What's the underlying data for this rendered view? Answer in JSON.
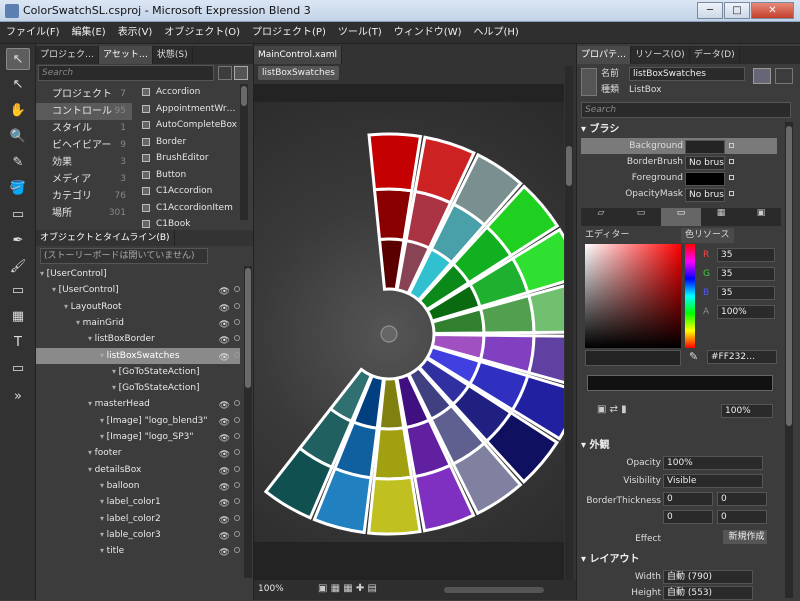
{
  "window": {
    "title": "ColorSwatchSL.csproj - Microsoft Expression Blend 3",
    "min": "─",
    "max": "□",
    "close": "✕"
  },
  "menu": [
    "ファイル(F)",
    "編集(E)",
    "表示(V)",
    "オブジェクト(O)",
    "プロジェクト(P)",
    "ツール(T)",
    "ウィンドウ(W)",
    "ヘルプ(H)"
  ],
  "toolbox": {
    "icons": [
      "selection-arrow-icon",
      "direct-select-icon",
      "pan-hand-icon",
      "zoom-icon",
      "eyedropper-icon",
      "paint-bucket-icon",
      "gradient-icon",
      "pen-icon",
      "brush-icon",
      "rectangle-icon",
      "grid-icon",
      "textblock-icon",
      "asset-icon",
      "expand-icon"
    ],
    "glyphs": [
      "↖",
      "↖",
      "✋",
      "🔍",
      "✎",
      "🪣",
      "▭",
      "✒",
      "🖌",
      "▭",
      "▦",
      "T",
      "▭",
      "»"
    ]
  },
  "assets": {
    "tabs": [
      "プロジェク…",
      "アセット…",
      "状態(S)"
    ],
    "search_placeholder": "Search",
    "categories": [
      {
        "label": "プロジェクト",
        "count": "7"
      },
      {
        "label": "コントロール",
        "count": "95"
      },
      {
        "label": "スタイル",
        "count": "1"
      },
      {
        "label": "ビヘイビアー",
        "count": "9"
      },
      {
        "label": "効果",
        "count": "3"
      },
      {
        "label": "メディア",
        "count": "3"
      },
      {
        "label": "カテゴリ",
        "count": "76"
      },
      {
        "label": "場所",
        "count": "301"
      }
    ],
    "items": [
      "Accordion",
      "AppointmentWr…",
      "AutoCompleteBox",
      "Border",
      "BrushEditor",
      "Button",
      "C1Accordion",
      "C1AccordionItem",
      "C1Book"
    ]
  },
  "objects": {
    "title": "オブジェクトとタイムライン(B)",
    "storyboard": "(ストーリーボードは開いていません)",
    "tree": [
      {
        "label": "[UserControl]",
        "indent": 0,
        "eye": false
      },
      {
        "label": "[UserControl]",
        "indent": 1,
        "eye": true
      },
      {
        "label": "LayoutRoot",
        "indent": 2,
        "eye": true
      },
      {
        "label": "mainGrid",
        "indent": 3,
        "eye": true
      },
      {
        "label": "listBoxBorder",
        "indent": 4,
        "eye": true
      },
      {
        "label": "listBoxSwatches",
        "indent": 5,
        "eye": true,
        "selected": true
      },
      {
        "label": "[GoToStateAction]",
        "indent": 6,
        "eye": false
      },
      {
        "label": "[GoToStateAction]",
        "indent": 6,
        "eye": false
      },
      {
        "label": "masterHead",
        "indent": 4,
        "eye": true
      },
      {
        "label": "[Image] \"logo_blend3\"",
        "indent": 5,
        "eye": true
      },
      {
        "label": "[Image] \"logo_SP3\"",
        "indent": 5,
        "eye": true
      },
      {
        "label": "footer",
        "indent": 4,
        "eye": true
      },
      {
        "label": "detailsBox",
        "indent": 4,
        "eye": true
      },
      {
        "label": "balloon",
        "indent": 5,
        "eye": true
      },
      {
        "label": "label_color1",
        "indent": 5,
        "eye": true
      },
      {
        "label": "label_color2",
        "indent": 5,
        "eye": true
      },
      {
        "label": "lable_color3",
        "indent": 5,
        "eye": true
      },
      {
        "label": "title",
        "indent": 5,
        "eye": true
      }
    ]
  },
  "document": {
    "tab": "MainControl.xaml",
    "breadcrumb": "listBoxSwatches",
    "zoom": "100%"
  },
  "properties": {
    "tabs": [
      "プロパテ…",
      "リソース(O)",
      "データ(D)"
    ],
    "name_label": "名前",
    "name_value": "listBoxSwatches",
    "type_label": "種類",
    "type_value": "ListBox",
    "search_placeholder": "Search",
    "brush_section": "ブラシ",
    "brushes": [
      {
        "label": "Background",
        "value": ""
      },
      {
        "label": "BorderBrush",
        "value": "No brush"
      },
      {
        "label": "Foreground",
        "value": ""
      },
      {
        "label": "OpacityMask",
        "value": "No brush"
      }
    ],
    "editor_tab": "エディター",
    "resource_tab": "色リソース",
    "rgba": [
      {
        "k": "R",
        "v": "35"
      },
      {
        "k": "G",
        "v": "35"
      },
      {
        "k": "B",
        "v": "35"
      },
      {
        "k": "A",
        "v": "100%"
      }
    ],
    "hex": "#FF232…",
    "gradient_zoom": "100%",
    "appearance_section": "外観",
    "opacity_label": "Opacity",
    "opacity_value": "100%",
    "visibility_label": "Visibility",
    "visibility_value": "Visible",
    "border_label": "BorderThickness",
    "border_vals": [
      "0",
      "0",
      "0",
      "0"
    ],
    "effect_label": "Effect",
    "effect_btn": "新規作成",
    "layout_section": "レイアウト",
    "width_label": "Width",
    "width_value": "自動 (790)",
    "height_label": "Height",
    "height_value": "自動 (553)"
  },
  "colors": {
    "accent": "#d8d8d8",
    "panel": "#3c3c3c",
    "background_brush": "#232323"
  }
}
